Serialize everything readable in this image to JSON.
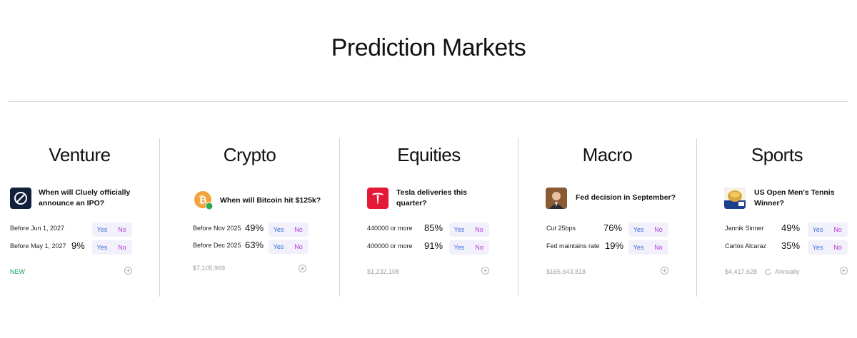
{
  "page": {
    "title": "Prediction Markets"
  },
  "categories": [
    {
      "title": "Venture",
      "icon": "cluely-logo-icon",
      "question": [
        "When will Cluely officially",
        "announce an IPO?"
      ],
      "rows": [
        {
          "label": "Before Jun 1, 2027",
          "pct": "",
          "yes": "Yes",
          "no": "No"
        },
        {
          "label": "Before May 1, 2027",
          "pct": "9%",
          "yes": "Yes",
          "no": "No"
        }
      ],
      "footer": "NEW"
    },
    {
      "title": "Crypto",
      "icon": "bitcoin-icon",
      "question": [
        "When will Bitcoin hit $125k?"
      ],
      "rows": [
        {
          "label": "Before Nov 2025",
          "pct": "49%",
          "yes": "Yes",
          "no": "No"
        },
        {
          "label": "Before Dec 2025",
          "pct": "63%",
          "yes": "Yes",
          "no": "No"
        }
      ],
      "footer": "$7,105,969"
    },
    {
      "title": "Equities",
      "icon": "tesla-logo-icon",
      "question": [
        "Tesla deliveries this",
        "quarter?"
      ],
      "rows": [
        {
          "label": "440000 or more",
          "pct": "85%",
          "yes": "Yes",
          "no": "No"
        },
        {
          "label": "400000 or more",
          "pct": "91%",
          "yes": "Yes",
          "no": "No"
        }
      ],
      "footer": "$1,232,108"
    },
    {
      "title": "Macro",
      "icon": "fed-chair-portrait-icon",
      "question": [
        "Fed decision in September?"
      ],
      "rows": [
        {
          "label": "Cut 25bps",
          "pct": "76%",
          "yes": "Yes",
          "no": "No"
        },
        {
          "label": "Fed maintains rate",
          "pct": "19%",
          "yes": "Yes",
          "no": "No"
        }
      ],
      "footer": "$165,643,818"
    },
    {
      "title": "Sports",
      "icon": "tennis-trophy-icon",
      "question": [
        "US Open Men's Tennis",
        "Winner?"
      ],
      "rows": [
        {
          "label": "Jannik Sinner",
          "pct": "49%",
          "yes": "Yes",
          "no": "No"
        },
        {
          "label": "Carlos Alcaraz",
          "pct": "35%",
          "yes": "Yes",
          "no": "No"
        }
      ],
      "footer": "$4,417,628",
      "frequency": "Annually"
    }
  ],
  "colors": {
    "yes": "#3b6fd8",
    "no": "#b23ad6",
    "new": "#18a058",
    "pill_bg": "#f1f0fb"
  }
}
